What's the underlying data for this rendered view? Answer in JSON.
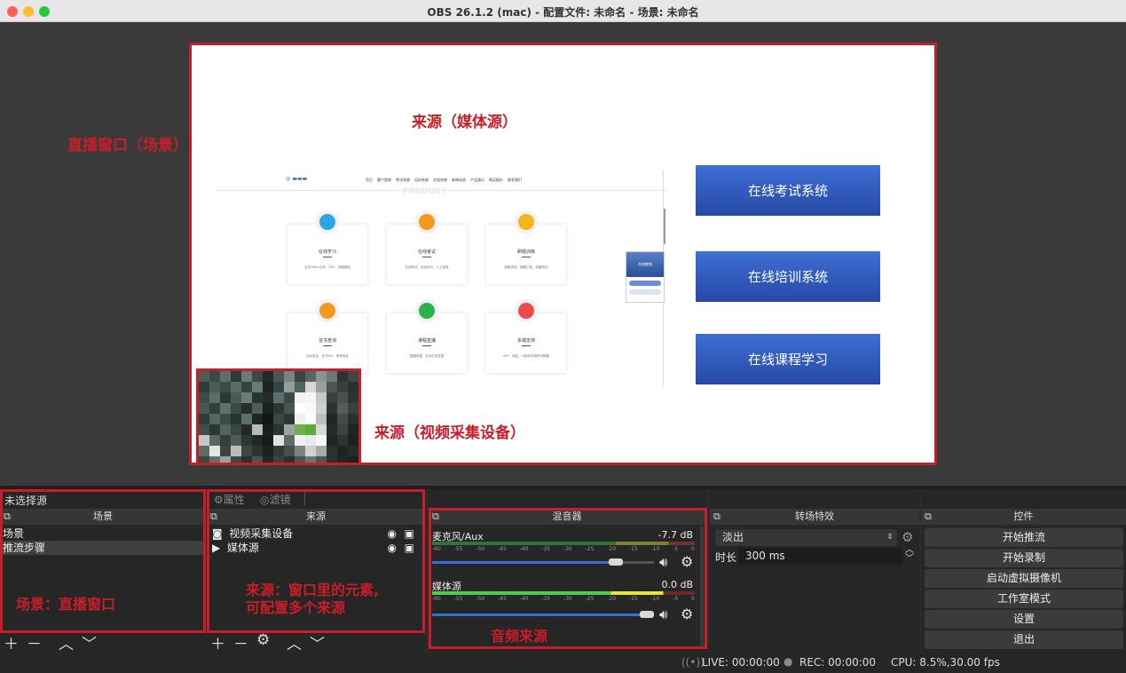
{
  "window": {
    "title": "OBS 26.1.2 (mac) - 配置文件: 未命名 - 场景: 未命名"
  },
  "annotations": {
    "scene_window": "直播窗口（场景）",
    "media_source": "来源（媒体源）",
    "video_source": "来源（视频采集设备）",
    "scenes_note": "场景：直播窗口",
    "sources_note_1": "来源：窗口里的元素,",
    "sources_note_2": "可配置多个来源",
    "audio_note": "音频来源"
  },
  "preview": {
    "website": {
      "nav": [
        "首页",
        "客户案例",
        "考试系统",
        "培训系统",
        "文档系统",
        "新闻动态",
        "产品演示",
        "购买报价",
        "联系我们"
      ],
      "faded_text": "PRODUCT",
      "cards": [
        {
          "title": "在线学习",
          "desc": "支持Office文件、PDF、视频播放",
          "color": "#2aa6e8"
        },
        {
          "title": "在线考试",
          "desc": "在线考试、自动判分、人工批卷",
          "color": "#f39a1e"
        },
        {
          "title": "刷题训练",
          "desc": "刷题训练、错题记录、收藏笔记",
          "color": "#f5b51b"
        },
        {
          "title": "证书查询",
          "desc": "自动发证、证书DIY、营审验证",
          "color": "#f39a1e"
        },
        {
          "title": "课程直播",
          "desc": "直播授课、互动交流答疑",
          "color": "#2bb24c"
        },
        {
          "title": "多端支持",
          "desc": "APP、网站、小程序多端考试刷题",
          "color": "#ea4b4b"
        }
      ],
      "side_title": "在线教育"
    },
    "buttons": [
      "在线考试系统",
      "在线培训系统",
      "在线课程学习"
    ]
  },
  "source_toolbar": {
    "no_source": "未选择源",
    "properties": "属性",
    "filters": "滤镜"
  },
  "scenes": {
    "header": "场景",
    "items": [
      "场景",
      "推流步骤"
    ]
  },
  "sources": {
    "header": "来源",
    "items": [
      {
        "name": "视频采集设备",
        "icon": "camera-icon"
      },
      {
        "name": "媒体源",
        "icon": "play-icon"
      }
    ]
  },
  "mixer": {
    "header": "混音器",
    "scale": [
      "-60",
      "-55",
      "-50",
      "-45",
      "-40",
      "-35",
      "-30",
      "-25",
      "-20",
      "-15",
      "-10",
      "-5",
      "0"
    ],
    "channels": [
      {
        "name": "麦克风/Aux",
        "db": "-7.7 dB",
        "volume": 0.86
      },
      {
        "name": "媒体源",
        "db": "0.0 dB",
        "volume": 1.0
      }
    ]
  },
  "transitions": {
    "header": "转场特效",
    "selected": "淡出",
    "duration_label": "时长",
    "duration": "300 ms"
  },
  "controls": {
    "header": "控件",
    "buttons": [
      "开始推流",
      "开始录制",
      "启动虚拟摄像机",
      "工作室模式",
      "设置",
      "退出"
    ]
  },
  "status": {
    "live": "LIVE: 00:00:00",
    "rec": "REC: 00:00:00",
    "cpu": "CPU: 8.5%,30.00 fps"
  },
  "colors": {
    "accent": "#c81e2a",
    "slider": "#3470d6"
  }
}
